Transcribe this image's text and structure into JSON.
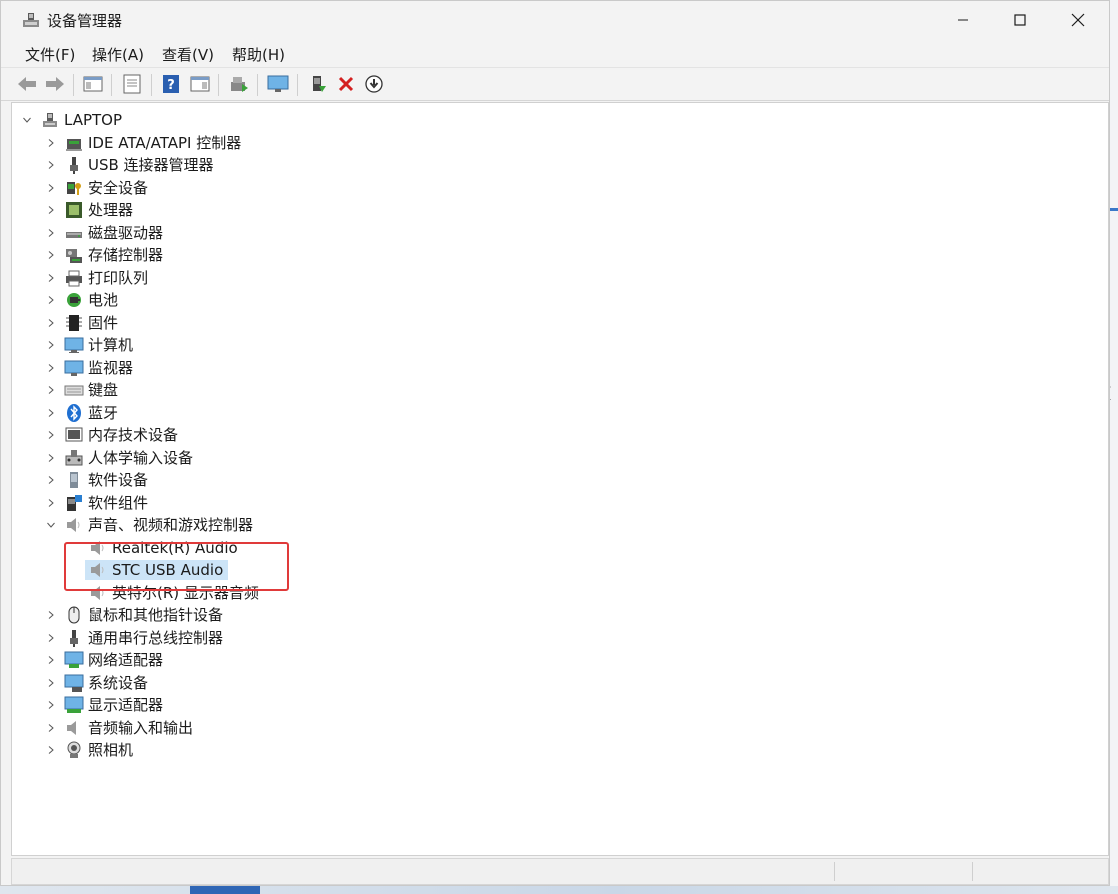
{
  "window": {
    "title": "设备管理器"
  },
  "menu": [
    "文件(F)",
    "操作(A)",
    "查看(V)",
    "帮助(H)"
  ],
  "toolbar": [
    "back-icon",
    "forward-icon",
    "show-hide-tree-icon",
    "properties-icon",
    "help-icon",
    "action-pane-icon",
    "scan-hardware-icon",
    "monitor-icon",
    "update-driver-icon",
    "uninstall-icon",
    "download-icon"
  ],
  "tree": {
    "root": "LAPTOP",
    "categories": [
      {
        "label": "IDE ATA/ATAPI 控制器",
        "icon": "ide-controller-icon"
      },
      {
        "label": "USB 连接器管理器",
        "icon": "usb-connector-icon"
      },
      {
        "label": "安全设备",
        "icon": "security-device-icon"
      },
      {
        "label": "处理器",
        "icon": "processor-icon"
      },
      {
        "label": "磁盘驱动器",
        "icon": "disk-drive-icon"
      },
      {
        "label": "存储控制器",
        "icon": "storage-controller-icon"
      },
      {
        "label": "打印队列",
        "icon": "printer-icon"
      },
      {
        "label": "电池",
        "icon": "battery-icon"
      },
      {
        "label": "固件",
        "icon": "firmware-icon"
      },
      {
        "label": "计算机",
        "icon": "computer-icon"
      },
      {
        "label": "监视器",
        "icon": "monitor-icon"
      },
      {
        "label": "键盘",
        "icon": "keyboard-icon"
      },
      {
        "label": "蓝牙",
        "icon": "bluetooth-icon"
      },
      {
        "label": "内存技术设备",
        "icon": "memory-device-icon"
      },
      {
        "label": "人体学输入设备",
        "icon": "hid-icon"
      },
      {
        "label": "软件设备",
        "icon": "software-device-icon"
      },
      {
        "label": "软件组件",
        "icon": "software-component-icon"
      },
      {
        "label": "声音、视频和游戏控制器",
        "icon": "speaker-icon",
        "expanded": true,
        "children": [
          {
            "label": "Realtek(R) Audio",
            "icon": "speaker-icon"
          },
          {
            "label": "STC USB Audio",
            "icon": "speaker-icon",
            "selected": true
          },
          {
            "label": "英特尔(R) 显示器音频",
            "icon": "speaker-icon"
          }
        ]
      },
      {
        "label": "鼠标和其他指针设备",
        "icon": "mouse-icon"
      },
      {
        "label": "通用串行总线控制器",
        "icon": "usb-controller-icon"
      },
      {
        "label": "网络适配器",
        "icon": "network-adapter-icon"
      },
      {
        "label": "系统设备",
        "icon": "system-device-icon"
      },
      {
        "label": "显示适配器",
        "icon": "display-adapter-icon"
      },
      {
        "label": "音频输入和输出",
        "icon": "audio-io-icon"
      },
      {
        "label": "照相机",
        "icon": "camera-icon"
      }
    ]
  },
  "desktop_glyph": "[",
  "colors": {
    "selection": "#cce4f7",
    "highlight_box": "#e03a3a",
    "accent": "#3a78c8"
  }
}
